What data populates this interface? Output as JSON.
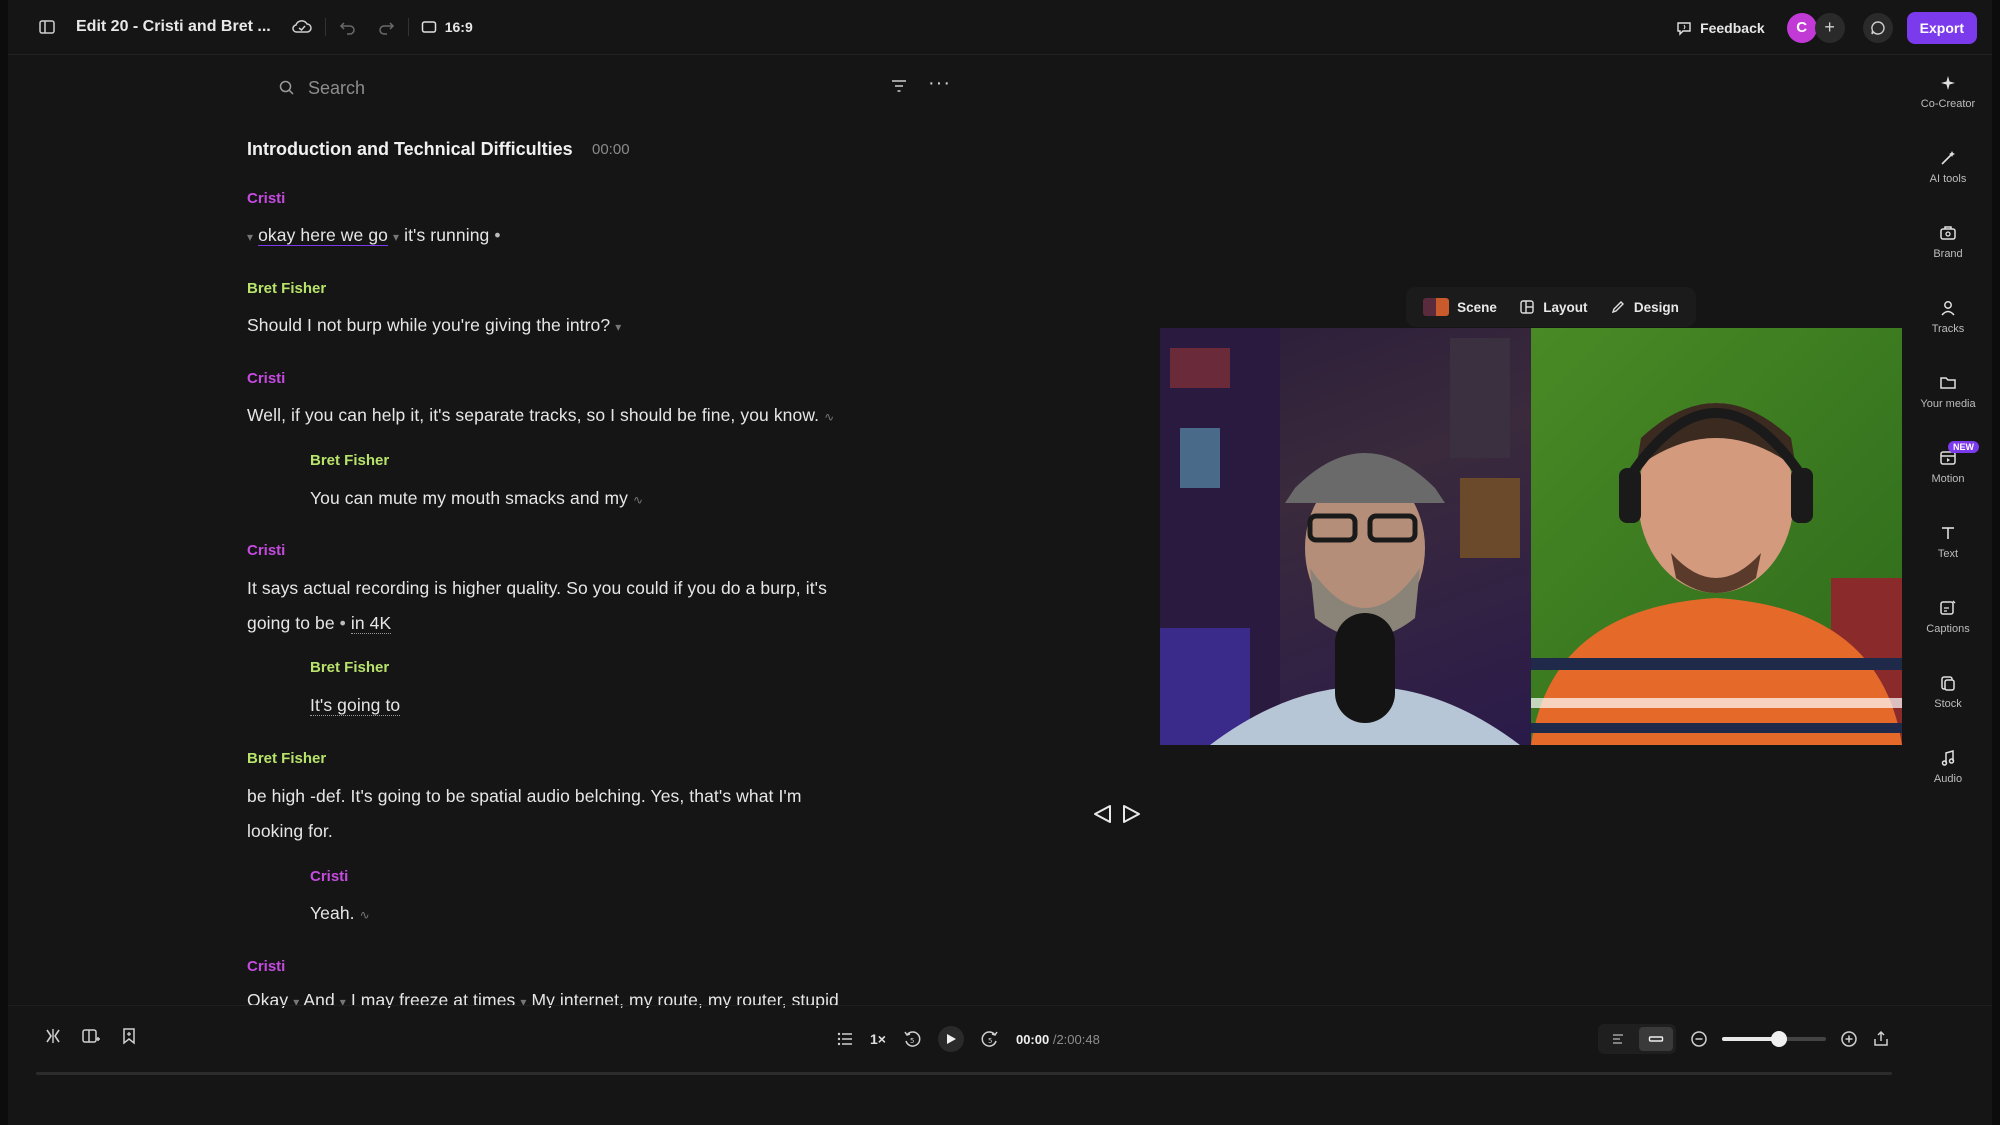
{
  "topbar": {
    "title": "Edit 20 - Cristi and Bret ...",
    "aspect_ratio": "16:9",
    "feedback_label": "Feedback",
    "avatar_initial": "C",
    "add_label": "+",
    "export_label": "Export"
  },
  "search": {
    "placeholder": "Search",
    "more": "···"
  },
  "transcript": {
    "chapter_title": "Introduction and Technical Difficulties",
    "chapter_time": "00:00",
    "blocks": [
      {
        "speaker": "Cristi",
        "lines": [
          "okay here we go",
          "it's running"
        ]
      },
      {
        "speaker": "Bret Fisher",
        "lines": [
          "Should I not burp while you're giving the intro?"
        ]
      },
      {
        "speaker": "Cristi",
        "lines": [
          "Well, if you can help it, it's separate tracks, so I should be fine, you know."
        ]
      },
      {
        "speaker": "Bret Fisher",
        "lines": [
          "You can mute my mouth smacks and my"
        ]
      },
      {
        "speaker": "Cristi",
        "lines": [
          "It says actual recording is higher quality. So you could if you do a burp, it's",
          "going to be",
          "in 4K"
        ]
      },
      {
        "speaker": "Bret Fisher",
        "lines": [
          "It's going to"
        ]
      },
      {
        "speaker": "Bret Fisher",
        "lines": [
          "be high -def. It's going to be spatial audio belching. Yes, that's what I'm",
          "looking for."
        ]
      },
      {
        "speaker": "Cristi",
        "lines": [
          "Yeah."
        ]
      },
      {
        "speaker": "Cristi",
        "lines": [
          "Okay",
          "And",
          "I may freeze at times",
          "My internet, my route, my router, stupid"
        ]
      }
    ]
  },
  "preview": {
    "scene_label": "Scene",
    "layout_label": "Layout",
    "design_label": "Design"
  },
  "sidebar": {
    "items": [
      {
        "label": "Co-Creator"
      },
      {
        "label": "AI tools"
      },
      {
        "label": "Brand"
      },
      {
        "label": "Tracks"
      },
      {
        "label": "Your media"
      },
      {
        "label": "Motion",
        "badge": "NEW"
      },
      {
        "label": "Text"
      },
      {
        "label": "Captions"
      },
      {
        "label": "Stock"
      },
      {
        "label": "Audio"
      }
    ]
  },
  "player": {
    "speed": "1×",
    "current_time": "00:00",
    "duration": "/2:00:48",
    "zoom_level": 0.55
  },
  "colors": {
    "accent": "#7c3aed",
    "cristi": "#c54be0",
    "bret": "#b8e36b"
  }
}
